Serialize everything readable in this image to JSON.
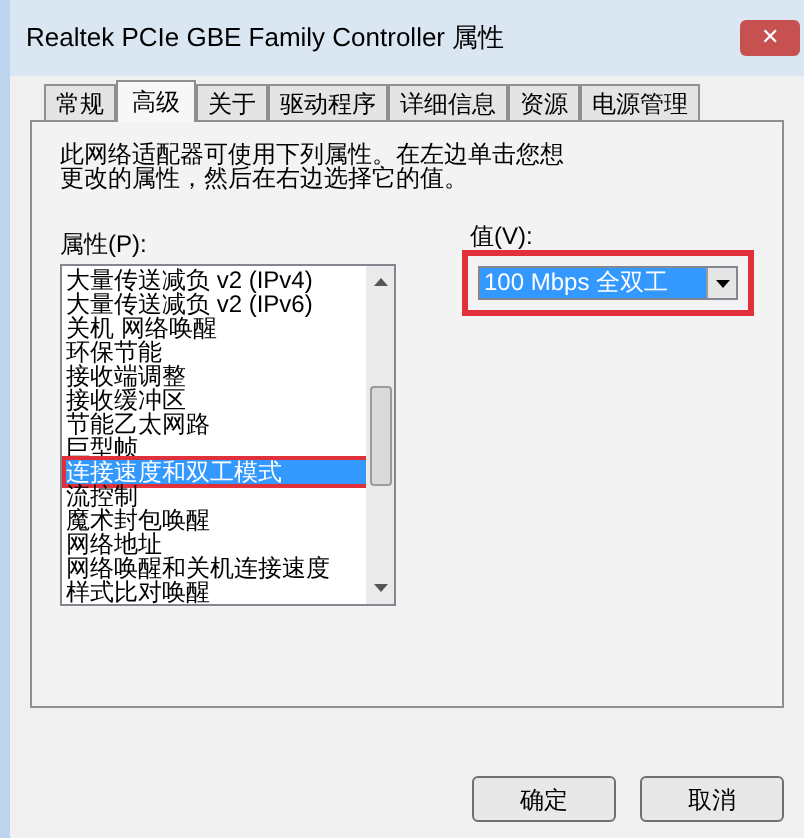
{
  "window": {
    "title": "Realtek PCIe GBE Family Controller 属性",
    "close": "✕"
  },
  "tabs": [
    {
      "label": "常规",
      "selected": false
    },
    {
      "label": "高级",
      "selected": true
    },
    {
      "label": "关于",
      "selected": false
    },
    {
      "label": "驱动程序",
      "selected": false
    },
    {
      "label": "详细信息",
      "selected": false
    },
    {
      "label": "资源",
      "selected": false
    },
    {
      "label": "电源管理",
      "selected": false
    }
  ],
  "description": "此网络适配器可使用下列属性。在左边单击您想更改的属性，然后在右边选择它的值。",
  "property_label": "属性(P):",
  "properties": [
    {
      "label": "大量传送减负 v2 (IPv4)",
      "selected": false
    },
    {
      "label": "大量传送减负 v2 (IPv6)",
      "selected": false
    },
    {
      "label": "关机 网络唤醒",
      "selected": false
    },
    {
      "label": "环保节能",
      "selected": false
    },
    {
      "label": "接收端调整",
      "selected": false
    },
    {
      "label": "接收缓冲区",
      "selected": false
    },
    {
      "label": "节能乙太网路",
      "selected": false
    },
    {
      "label": "巨型帧",
      "selected": false
    },
    {
      "label": "连接速度和双工模式",
      "selected": true
    },
    {
      "label": "流控制",
      "selected": false
    },
    {
      "label": "魔术封包唤醒",
      "selected": false
    },
    {
      "label": "网络地址",
      "selected": false
    },
    {
      "label": "网络唤醒和关机连接速度",
      "selected": false
    },
    {
      "label": "样式比对唤醒",
      "selected": false
    }
  ],
  "value_label": "值(V):",
  "value": "100 Mbps 全双工",
  "buttons": [
    "确定",
    "取消"
  ]
}
